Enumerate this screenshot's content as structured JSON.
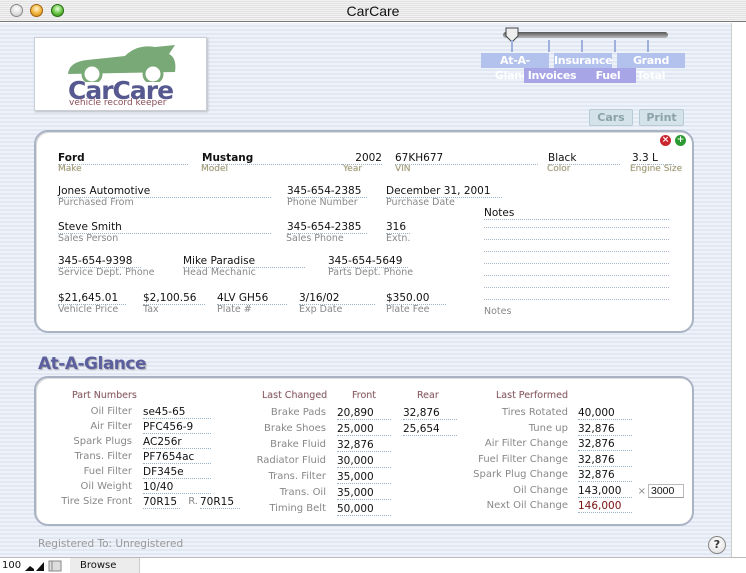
{
  "window": {
    "title": "CarCare"
  },
  "logo": {
    "brand": "CarCare",
    "tagline": "vehicle record keeper"
  },
  "nav": {
    "slider_position_index": 0,
    "tabs_row1": [
      "At-A-Glance",
      "Insurance",
      "Grand Total"
    ],
    "tabs_row2": [
      "Invoices",
      "Fuel"
    ],
    "cars_label": "Cars",
    "print_label": "Print"
  },
  "vehicle": {
    "make": {
      "value": "Ford",
      "label": "Make"
    },
    "model": {
      "value": "Mustang",
      "label": "Model"
    },
    "year": {
      "value": "2002",
      "label": "Year"
    },
    "vin": {
      "value": "67KH677",
      "label": "VIN"
    },
    "color": {
      "value": "Black",
      "label": "Color"
    },
    "engine": {
      "value": "3.3 L",
      "label": "Engine Size"
    },
    "purchased_from": {
      "value": "Jones Automotive",
      "label": "Purchased From"
    },
    "phone": {
      "value": "345-654-2385",
      "label": "Phone Number"
    },
    "purchase_date": {
      "value": "December 31, 2001",
      "label": "Purchase Date"
    },
    "sales_person": {
      "value": "Steve Smith",
      "label": "Sales Person"
    },
    "sales_phone": {
      "value": "345-654-2385",
      "label": "Sales Phone"
    },
    "extn": {
      "value": "316",
      "label": "Extn."
    },
    "service_phone": {
      "value": "345-654-9398",
      "label": "Service Dept. Phone"
    },
    "head_mechanic": {
      "value": "Mike Paradise",
      "label": "Head Mechanic"
    },
    "parts_phone": {
      "value": "345-654-5649",
      "label": "Parts Dept. Phone"
    },
    "price": {
      "value": "$21,645.01",
      "label": "Vehicle Price"
    },
    "tax": {
      "value": "$2,100.56",
      "label": "Tax"
    },
    "plate": {
      "value": "4LV GH56",
      "label": "Plate #"
    },
    "exp_date": {
      "value": "3/16/02",
      "label": "Exp Date"
    },
    "plate_fee": {
      "value": "$350.00",
      "label": "Plate Fee"
    },
    "notes_title": "Notes",
    "notes_label": "Notes"
  },
  "glance": {
    "title": "At-A-Glance",
    "parts_header": "Part Numbers",
    "parts": [
      {
        "label": "Oil Filter",
        "value": "se45-65"
      },
      {
        "label": "Air Filter",
        "value": "PFC456-9"
      },
      {
        "label": "Spark Plugs",
        "value": "AC256r"
      },
      {
        "label": "Trans. Filter",
        "value": "PF7654ac"
      },
      {
        "label": "Fuel Filter",
        "value": "DF345e"
      },
      {
        "label": "Oil Weight",
        "value": "10/40"
      }
    ],
    "tire": {
      "label": "Tire Size Front",
      "front": "70R15",
      "rear_label": "R.",
      "rear": "70R15"
    },
    "changed_header": "Last Changed",
    "front_header": "Front",
    "rear_header": "Rear",
    "changed": [
      {
        "label": "Brake Pads",
        "front": "20,890",
        "rear": "32,876"
      },
      {
        "label": "Brake Shoes",
        "front": "25,000",
        "rear": "25,654"
      },
      {
        "label": "Brake Fluid",
        "front": "32,876",
        "rear": ""
      },
      {
        "label": "Radiator Fluid",
        "front": "30,000",
        "rear": ""
      },
      {
        "label": "Trans. Filter",
        "front": "35,000",
        "rear": ""
      },
      {
        "label": "Trans. Oil",
        "front": "35,000",
        "rear": ""
      },
      {
        "label": "Timing Belt",
        "front": "50,000",
        "rear": ""
      }
    ],
    "performed_header": "Last Performed",
    "performed": [
      {
        "label": "Tires Rotated",
        "value": "40,000"
      },
      {
        "label": "Tune up",
        "value": "32,876"
      },
      {
        "label": "Air Filter Change",
        "value": "32,876"
      },
      {
        "label": "Fuel Filter Change",
        "value": "32,876"
      },
      {
        "label": "Spark Plug Change",
        "value": "32,876"
      },
      {
        "label": "Oil Change",
        "value": "143,000"
      },
      {
        "label": "Next Oil Change",
        "value": "146,000"
      }
    ],
    "interval_prefix": "×",
    "interval_value": "3000"
  },
  "footer": {
    "registered": "Registered To: Unregistered",
    "help": "?"
  },
  "statusbar": {
    "zoom": "100",
    "mode": "Browse"
  }
}
